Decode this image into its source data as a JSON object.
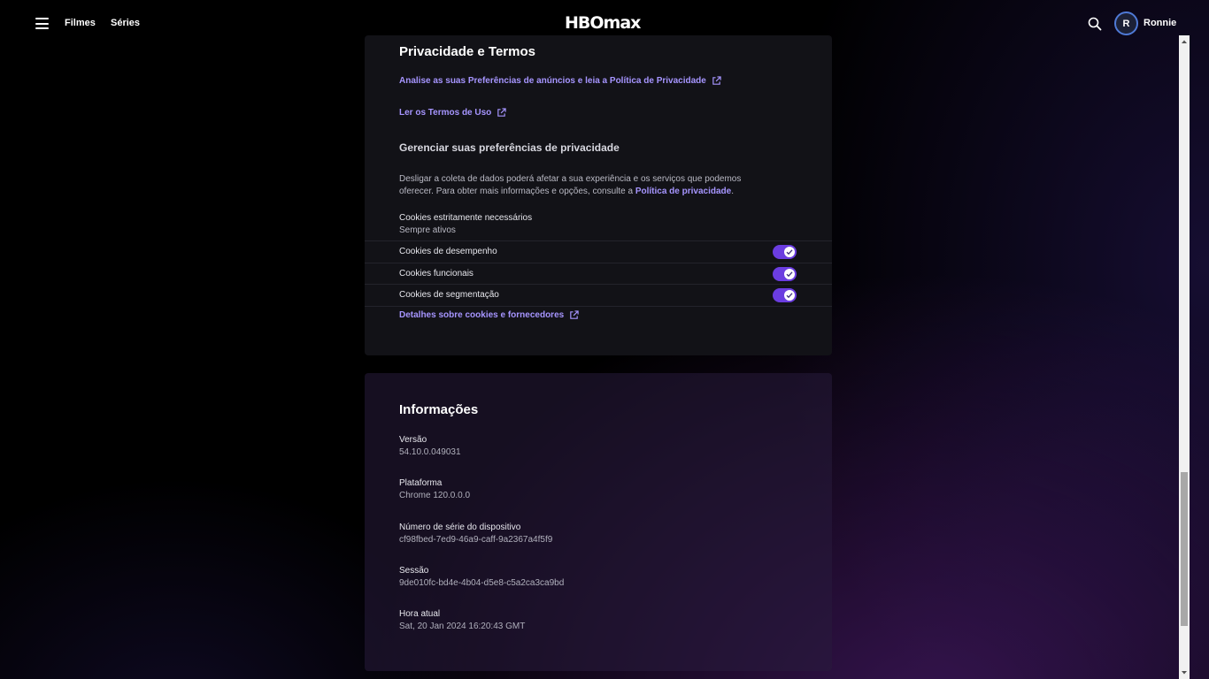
{
  "nav": {
    "films_label": "Filmes",
    "series_label": "Séries",
    "logo_text": "HBOmax",
    "user_initial": "R",
    "user_name": "Ronnie"
  },
  "privacy": {
    "title": "Privacidade e Termos",
    "ads_link": "Analise as suas Preferências de anúncios e leia a Política de Privacidade",
    "terms_link": "Ler os Termos de Uso",
    "manage_heading": "Gerenciar suas preferências de privacidade",
    "description": "Desligar a coleta de dados poderá afetar a sua experiência e os serviços que podemos oferecer. Para obter mais informações e opções, consulte a ",
    "description_link": "Política de privacidade",
    "description_end": ".",
    "strict_cookies_label": "Cookies estritamente necessários",
    "strict_cookies_status": "Sempre ativos",
    "cookies": [
      {
        "label": "Cookies de desempenho",
        "enabled": true
      },
      {
        "label": "Cookies funcionais",
        "enabled": true
      },
      {
        "label": "Cookies de segmentação",
        "enabled": true
      }
    ],
    "details_link": "Detalhes sobre cookies e fornecedores"
  },
  "info": {
    "title": "Informações",
    "items": [
      {
        "label": "Versão",
        "value": "54.10.0.049031"
      },
      {
        "label": "Plataforma",
        "value": "Chrome 120.0.0.0"
      },
      {
        "label": "Número de série do dispositivo",
        "value": "cf98fbed-7ed9-46a9-caff-9a2367a4f5f9"
      },
      {
        "label": "Sessão",
        "value": "9de010fc-bd4e-4b04-d5e8-c5a2ca3ca9bd"
      },
      {
        "label": "Hora atual",
        "value": "Sat, 20 Jan 2024 16:20:43 GMT"
      }
    ]
  },
  "colors": {
    "accent": "#a695ff",
    "toggle": "#6b3de0"
  }
}
